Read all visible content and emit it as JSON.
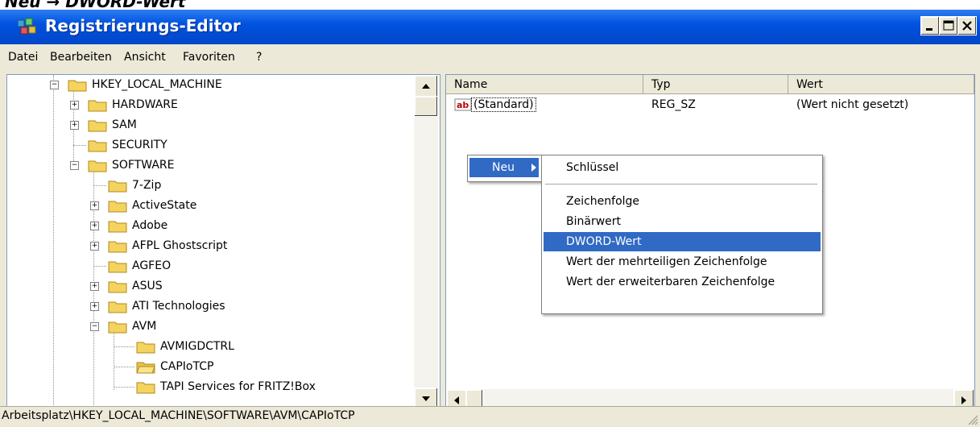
{
  "top_text": "Neu → DWORD-Wert",
  "window": {
    "title": "Registrierungs-Editor",
    "buttons": {
      "minimize": "minimize-icon",
      "maximize": "maximize-icon",
      "close": "close-icon"
    }
  },
  "menu": [
    "Datei",
    "Bearbeiten",
    "Ansicht",
    "Favoriten",
    "?"
  ],
  "tree": {
    "items": [
      {
        "label": "HKEY_LOCAL_MACHINE"
      },
      {
        "label": "HARDWARE"
      },
      {
        "label": "SAM"
      },
      {
        "label": "SECURITY"
      },
      {
        "label": "SOFTWARE"
      },
      {
        "label": "7-Zip"
      },
      {
        "label": "ActiveState"
      },
      {
        "label": "Adobe"
      },
      {
        "label": "AFPL Ghostscript"
      },
      {
        "label": "AGFEO"
      },
      {
        "label": "ASUS"
      },
      {
        "label": "ATI Technologies"
      },
      {
        "label": "AVM"
      },
      {
        "label": "AVMIGDCTRL"
      },
      {
        "label": "CAPIoTCP"
      },
      {
        "label": "TAPI Services for FRITZ!Box"
      }
    ]
  },
  "list": {
    "columns": [
      "Name",
      "Typ",
      "Wert"
    ],
    "rows": [
      {
        "name": "(Standard)",
        "type": "REG_SZ",
        "value": "(Wert nicht gesetzt)",
        "icon": "string-value-icon"
      }
    ]
  },
  "context_menu": {
    "parent_label": "Neu",
    "submenu": [
      "Schlüssel",
      "Zeichenfolge",
      "Binärwert",
      "DWORD-Wert",
      "Wert der mehrteiligen Zeichenfolge",
      "Wert der erweiterbaren Zeichenfolge"
    ],
    "selected": "DWORD-Wert"
  },
  "status": "Arbeitsplatz\\HKEY_LOCAL_MACHINE\\SOFTWARE\\AVM\\CAPIoTCP",
  "colors": {
    "titlebar": "#0052e0",
    "selection": "#316ac5",
    "face": "#ece9d8",
    "folder": "#f4d35e"
  }
}
